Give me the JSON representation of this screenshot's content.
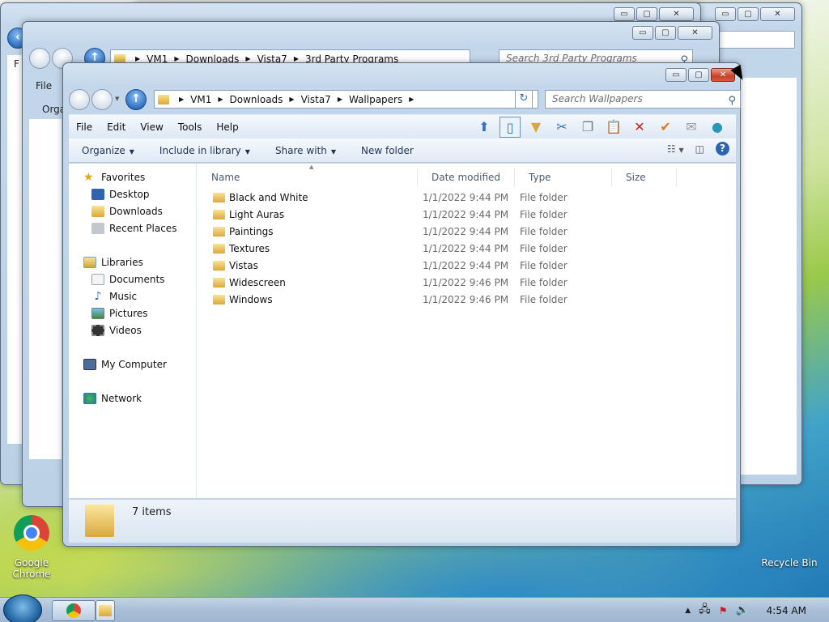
{
  "desktop": {
    "icons": [
      {
        "label": "Google Chrome",
        "label_line1": "Google",
        "label_line2": "Chrome",
        "icon": "chrome-icon"
      },
      {
        "label": "Recycle Bin",
        "icon": "recycle-bin-icon"
      }
    ]
  },
  "background_windows": [
    {
      "address": [
        "VM1",
        "Downloads",
        "Vista7",
        "3rd Party Programs"
      ],
      "search_placeholder": "Search 3rd Party Programs",
      "menu_first": "File",
      "command_first": "Orga"
    },
    {
      "menu_first": "F",
      "command_first": "Orga"
    }
  ],
  "window": {
    "caption_buttons": {
      "minimize": "▭",
      "maximize": "▢",
      "close": "✕"
    },
    "address": {
      "crumbs": [
        "VM1",
        "Downloads",
        "Vista7",
        "Wallpapers"
      ]
    },
    "search_placeholder": "Search Wallpapers",
    "menu": [
      "File",
      "Edit",
      "View",
      "Tools",
      "Help"
    ],
    "commands": {
      "organize": "Organize",
      "include": "Include in library",
      "share": "Share with",
      "new_folder": "New folder"
    },
    "nav_pane": {
      "favorites": "Favorites",
      "desktop": "Desktop",
      "downloads": "Downloads",
      "recent": "Recent Places",
      "libraries": "Libraries",
      "documents": "Documents",
      "music": "Music",
      "pictures": "Pictures",
      "videos": "Videos",
      "computer": "My Computer",
      "network": "Network"
    },
    "columns": {
      "name": "Name",
      "date": "Date modified",
      "type": "Type",
      "size": "Size"
    },
    "files": [
      {
        "name": "Black and White",
        "date": "1/1/2022 9:44 PM",
        "type": "File folder"
      },
      {
        "name": "Light Auras",
        "date": "1/1/2022 9:44 PM",
        "type": "File folder"
      },
      {
        "name": "Paintings",
        "date": "1/1/2022 9:44 PM",
        "type": "File folder"
      },
      {
        "name": "Textures",
        "date": "1/1/2022 9:44 PM",
        "type": "File folder"
      },
      {
        "name": "Vistas",
        "date": "1/1/2022 9:44 PM",
        "type": "File folder"
      },
      {
        "name": "Widescreen",
        "date": "1/1/2022 9:46 PM",
        "type": "File folder"
      },
      {
        "name": "Windows",
        "date": "1/1/2022 9:46 PM",
        "type": "File folder"
      }
    ],
    "status": "7 items"
  },
  "taskbar": {
    "clock": "4:54 AM"
  }
}
